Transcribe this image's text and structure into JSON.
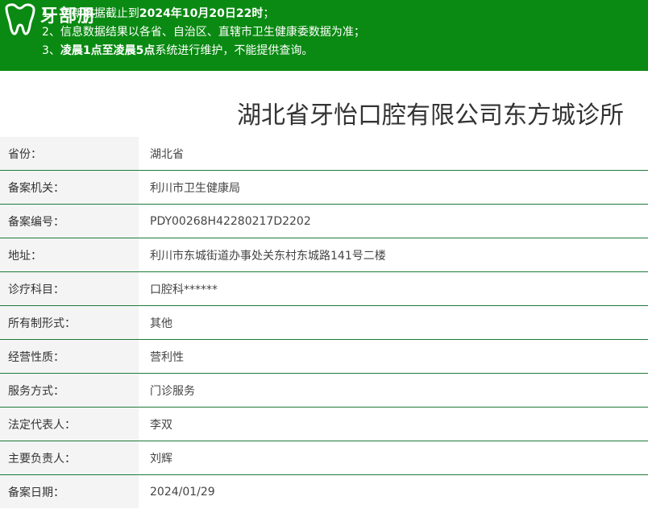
{
  "brand": {
    "logo_text": "牙部册"
  },
  "notice": {
    "line1_prefix": "1、更新数据截止到",
    "line1_bold": "2024年10月20日22时",
    "line1_suffix": "；",
    "line2": "2、信息数据结果以各省、自治区、直辖市卫生健康委数据为准；",
    "line3_prefix": "3、",
    "line3_bold": "凌晨1点至凌晨5点",
    "line3_suffix": "系统进行维护，不能提供查询。"
  },
  "title": "湖北省牙怡口腔有限公司东方城诊所",
  "rows": [
    {
      "label": "省份：",
      "value": "湖北省"
    },
    {
      "label": "备案机关：",
      "value": "利川市卫生健康局"
    },
    {
      "label": "备案编号：",
      "value": "PDY00268H42280217D2202"
    },
    {
      "label": "地址：",
      "value": "利川市东城街道办事处关东村东城路141号二楼"
    },
    {
      "label": "诊疗科目：",
      "value": "口腔科******"
    },
    {
      "label": "所有制形式：",
      "value": "其他"
    },
    {
      "label": "经营性质：",
      "value": "营利性"
    },
    {
      "label": "服务方式：",
      "value": "门诊服务"
    },
    {
      "label": "法定代表人：",
      "value": "李双"
    },
    {
      "label": "主要负责人：",
      "value": "刘辉"
    },
    {
      "label": "备案日期：",
      "value": "2024/01/29"
    }
  ],
  "colors": {
    "banner": "#0a8a12",
    "divider": "#1e7a3a"
  }
}
